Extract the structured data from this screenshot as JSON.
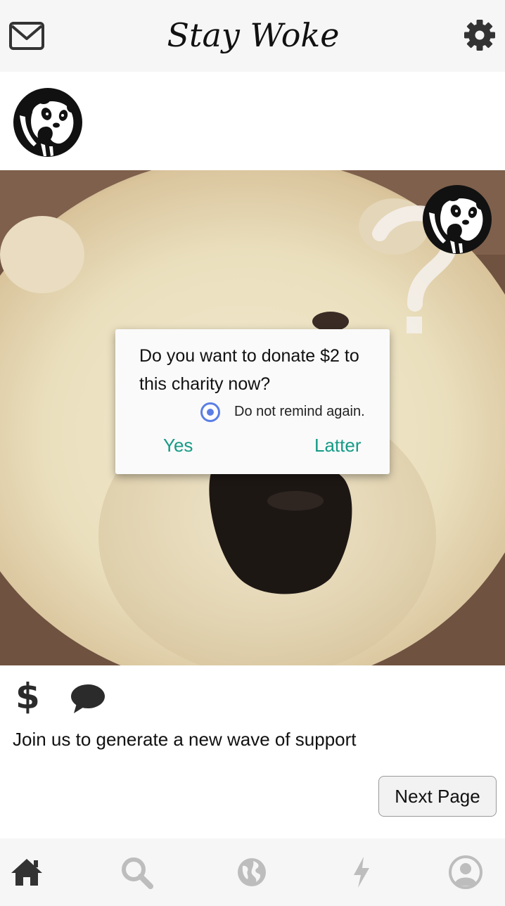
{
  "header": {
    "brand_name": "Stay Woke",
    "icons": {
      "left": "mail-icon",
      "right": "gear-icon"
    }
  },
  "post": {
    "author_avatar": "panda-logo",
    "caption": "Join us to generate a new wave of support",
    "actions": {
      "donate_icon": "$",
      "comment_icon": "comment-icon"
    }
  },
  "dialog": {
    "message": "Do you want to donate $2 to this charity now?",
    "checkbox_label": "Do not remind again.",
    "checkbox_checked": true,
    "yes_label": "Yes",
    "later_label": "Latter"
  },
  "next_button_label": "Next Page",
  "bottom_nav": {
    "items": [
      {
        "icon": "home-icon",
        "active": true
      },
      {
        "icon": "search-icon",
        "active": false
      },
      {
        "icon": "globe-icon",
        "active": false
      },
      {
        "icon": "bolt-icon",
        "active": false
      },
      {
        "icon": "profile-icon",
        "active": false
      }
    ]
  },
  "colors": {
    "accent_teal": "#169b86",
    "radio_blue": "#5b7ee5",
    "bar_background": "#f6f6f6",
    "inactive_icon": "#bdbdbd",
    "active_icon": "#333333"
  }
}
